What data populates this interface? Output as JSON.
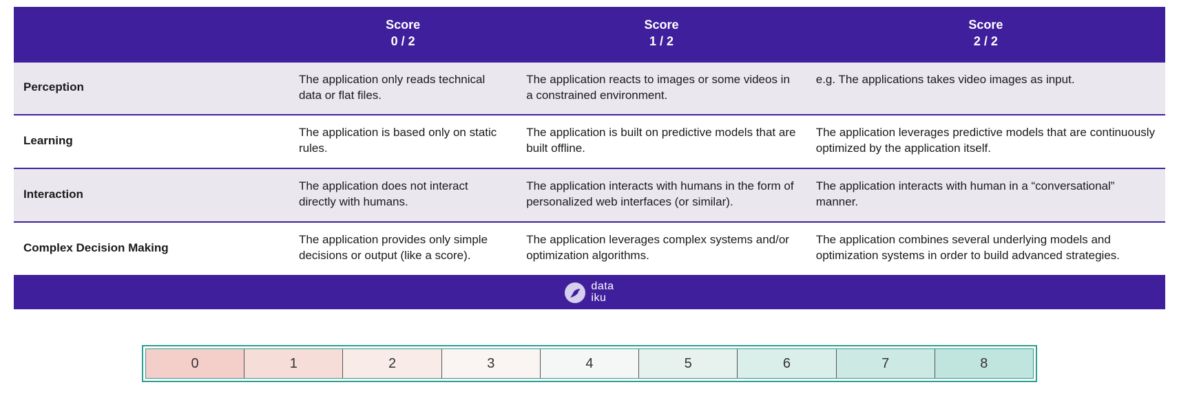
{
  "table": {
    "headers": {
      "blank": "",
      "score0": "Score\n0 / 2",
      "score1": "Score\n1 /  2",
      "score2": "Score\n2 / 2"
    },
    "rows": [
      {
        "label": "Perception",
        "s0": "The application only reads technical data or flat files.",
        "s1": "The application reacts to images or some videos in a constrained environment.",
        "s2": "e.g. The applications takes video images as input."
      },
      {
        "label": "Learning",
        "s0": " The application is based only on static rules.",
        "s1": "The application is built on predictive models that are built offline.",
        "s2": "The application leverages predictive models that are continuously optimized by the application itself."
      },
      {
        "label": "Interaction",
        "s0": "The application does not interact directly with humans.",
        "s1": "The application interacts with humans in the form of personalized web interfaces (or similar).",
        "s2": "The application interacts with human in a “conversational” manner."
      },
      {
        "label": "Complex Decision Making",
        "s0": "The application provides only simple decisions or output (like a score).",
        "s1": "The application leverages complex systems and/or optimization algorithms.",
        "s2": "The application combines several underlying models and optimization systems in order to build advanced strategies."
      }
    ]
  },
  "brand": {
    "line1": "data",
    "line2": "iku"
  },
  "scale": {
    "values": [
      "0",
      "1",
      "2",
      "3",
      "4",
      "5",
      "6",
      "7",
      "8"
    ],
    "colors": [
      "#f4cfc9",
      "#f6ddd8",
      "#f8ebe8",
      "#faf4f2",
      "#f4f7f5",
      "#e7f2ef",
      "#daeeea",
      "#cde9e4",
      "#c0e4de"
    ]
  }
}
